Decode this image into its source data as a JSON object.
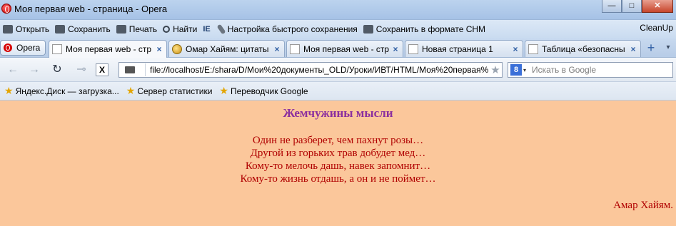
{
  "window": {
    "title": "Моя первая web - страница - Opera",
    "minimize": "—",
    "maximize": "□",
    "close": "✕"
  },
  "menubar": {
    "items": [
      {
        "label": "Открыть",
        "icon": "folder-icon"
      },
      {
        "label": "Сохранить",
        "icon": "save-icon"
      },
      {
        "label": "Печать",
        "icon": "print-icon"
      },
      {
        "label": "Найти",
        "icon": "search-icon"
      },
      {
        "label": "IE",
        "icon": "ie-icon"
      },
      {
        "label": "Настройка быстрого сохранения",
        "icon": "wrench-icon"
      },
      {
        "label": "Сохранить в формате CHM",
        "icon": "save-chm-icon"
      }
    ],
    "right": "CleanUp"
  },
  "tabbar": {
    "opera_button": "Opera",
    "tabs": [
      {
        "label": "Моя первая web - стр",
        "active": true
      },
      {
        "label": "Омар Хайям: цитаты",
        "active": false
      },
      {
        "label": "Моя первая web - стр",
        "active": false
      },
      {
        "label": "Новая страница 1",
        "active": false
      },
      {
        "label": "Таблица «безопасны",
        "active": false
      }
    ],
    "new_tab": "+",
    "menu": "▾"
  },
  "navbar": {
    "address": "file://localhost/E:/shara/D/Мои%20документы_OLD/Уроки/ИВТ/HTML/Моя%20первая%",
    "search_placeholder": "Искать в Google",
    "search_engine": "8",
    "stop": "X"
  },
  "bookmarks": [
    "Яндекс.Диск — загрузка...",
    "Сервер статистики",
    "Переводчик Google"
  ],
  "page": {
    "title": "Жемчужины мысли",
    "poem": [
      "Один не разберет, чем пахнут розы…",
      "Другой из горьких трав добудет мед…",
      "Кому-то мелочь дашь, навек запомнит…",
      "Кому-то жизнь отдашь, а он и не поймет…"
    ],
    "author": "Амар Хайям.",
    "colors": {
      "background": "#fbc79b",
      "title": "#8b2f9f",
      "text": "#b00000"
    }
  }
}
